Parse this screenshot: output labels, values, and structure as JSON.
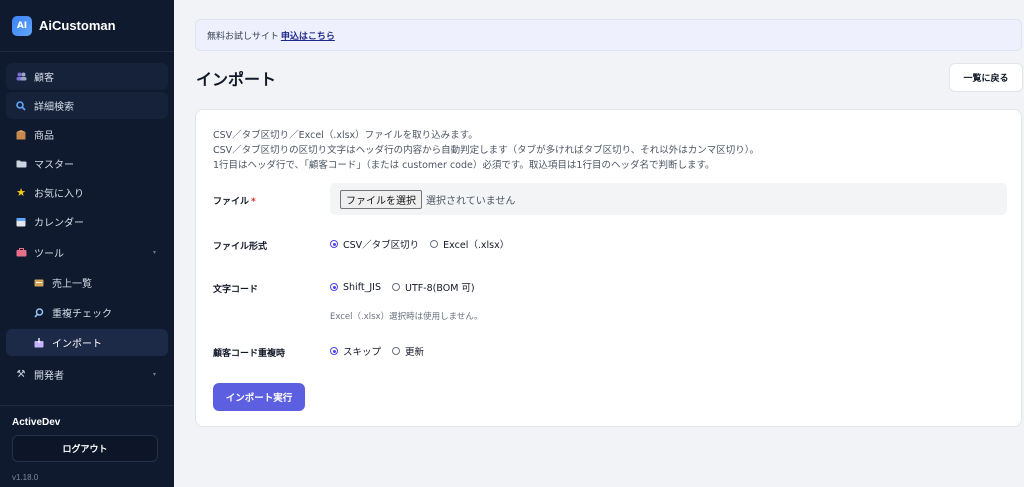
{
  "app": {
    "logo_text": "AI",
    "name": "AiCustoman"
  },
  "sidebar": {
    "items": [
      {
        "label": "顧客",
        "icon": "people-icon"
      },
      {
        "label": "詳細検索",
        "icon": "search-icon"
      },
      {
        "label": "商品",
        "icon": "box-icon"
      },
      {
        "label": "マスター",
        "icon": "folder-icon"
      },
      {
        "label": "お気に入り",
        "icon": "star-icon"
      },
      {
        "label": "カレンダー",
        "icon": "calendar-icon"
      },
      {
        "label": "ツール",
        "icon": "toolbox-icon"
      },
      {
        "label": "売上一覧",
        "icon": "sales-icon"
      },
      {
        "label": "重複チェック",
        "icon": "magnifier-icon"
      },
      {
        "label": "インポート",
        "icon": "inbox-icon"
      },
      {
        "label": "開発者",
        "icon": "tools-icon"
      }
    ],
    "user": "ActiveDev",
    "logout_label": "ログアウト",
    "version": "v1.18.0"
  },
  "notice": {
    "text": "無料お試しサイト",
    "link": "申込はこちら"
  },
  "page": {
    "title": "インポート",
    "back_label": "一覧に戻る"
  },
  "description": [
    "CSV／タブ区切り／Excel（.xlsx）ファイルを取り込みます。",
    "CSV／タブ区切りの区切り文字はヘッダ行の内容から自動判定します（タブが多ければタブ区切り、それ以外はカンマ区切り）。",
    "1行目はヘッダ行で、「顧客コード」（または customer code）必須です。取込項目は1行目のヘッダ名で判断します。"
  ],
  "form": {
    "file": {
      "label": "ファイル",
      "required_mark": "*",
      "button_label": "ファイルを選択",
      "status": "選択されていません"
    },
    "format": {
      "label": "ファイル形式",
      "options": [
        "CSV／タブ区切り",
        "Excel（.xlsx）"
      ],
      "selected": 0
    },
    "encoding": {
      "label": "文字コード",
      "options": [
        "Shift_JIS",
        "UTF-8(BOM 可)"
      ],
      "selected": 0,
      "hint": "Excel（.xlsx）選択時は使用しません。"
    },
    "duplicate": {
      "label": "顧客コード重複時",
      "options": [
        "スキップ",
        "更新"
      ],
      "selected": 0
    },
    "submit_label": "インポート実行"
  },
  "colors": {
    "sidebar_bg": "#0f1a2e",
    "accent": "#5b5fe0",
    "required": "#dc2626"
  }
}
